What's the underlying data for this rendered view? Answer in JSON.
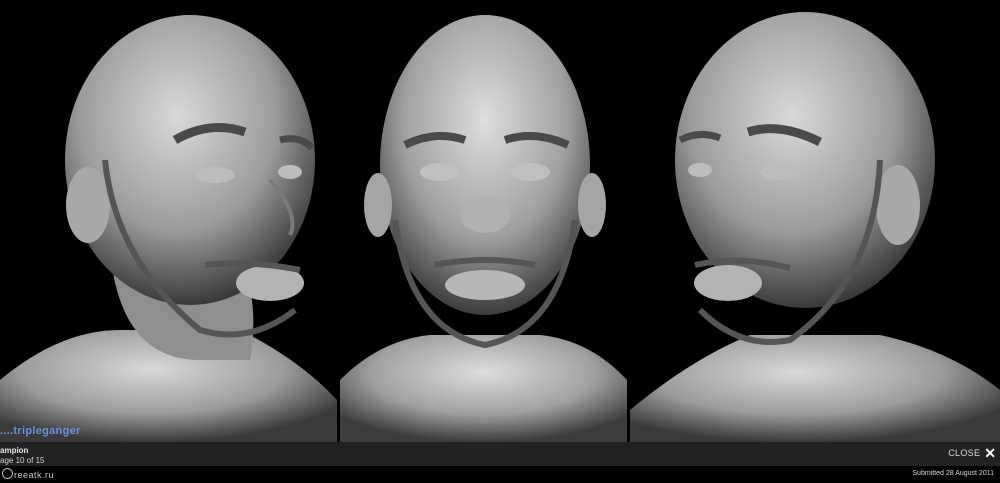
{
  "viewer": {
    "watermark": "....tripleganger"
  },
  "caption": {
    "title": "ampion",
    "page": "age 10 of 15"
  },
  "close": {
    "label": "CLOSE",
    "icon": "close-icon"
  },
  "footer": {
    "logo": "reeatk.ru",
    "submitted": "Submitted 28 August 2011"
  },
  "colors": {
    "background": "#000000",
    "caption_bar": "#222222",
    "watermark": "#6f8fe0"
  }
}
